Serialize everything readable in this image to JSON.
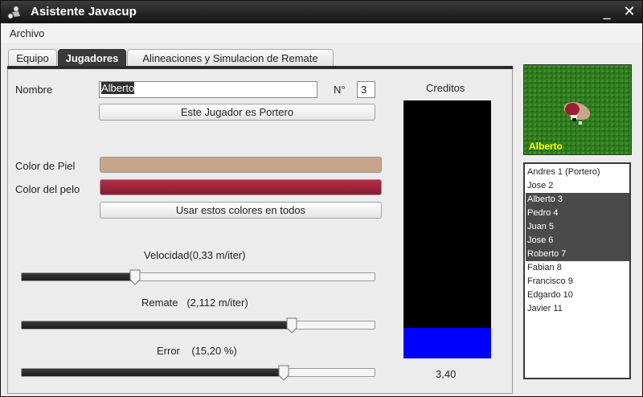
{
  "window": {
    "title": "Asistente Javacup",
    "minimize_glyph": "_",
    "close_glyph": "✕"
  },
  "menu": {
    "archivo": "Archivo"
  },
  "tabs": [
    {
      "label": "Equipo",
      "active": false
    },
    {
      "label": "Jugadores",
      "active": true
    },
    {
      "label": "Alineaciones y Simulacion de Remate",
      "active": false
    }
  ],
  "player": {
    "name_label": "Nombre",
    "name_value": "Alberto",
    "number_label": "N°",
    "number_value": "3",
    "goalkeeper_button": "Este Jugador es Portero",
    "skin_label": "Color de Piel",
    "hair_label": "Color del pelo",
    "skin_color": "#c8a58a",
    "hair_color": "#9a2035",
    "use_colors_button": "Usar estos colores en todos"
  },
  "sliders": {
    "speed": {
      "label": "Velocidad(0,33 m/iter)",
      "fraction": 0.32
    },
    "shot": {
      "label": "Remate   (2,112 m/iter)",
      "fraction": 0.78
    },
    "error": {
      "label": "Error    (15,20 %)",
      "fraction": 0.74
    }
  },
  "credits": {
    "title": "Creditos",
    "value": "3,40",
    "fill_fraction": 0.12
  },
  "preview": {
    "name": "Alberto"
  },
  "players": [
    {
      "label": "Andres 1 (Portero)",
      "selected": false
    },
    {
      "label": "Jose 2",
      "selected": false
    },
    {
      "label": "Alberto 3",
      "selected": true
    },
    {
      "label": "Pedro 4",
      "selected": true
    },
    {
      "label": "Juan 5",
      "selected": true
    },
    {
      "label": "Jose 6",
      "selected": true
    },
    {
      "label": "Roberto 7",
      "selected": true
    },
    {
      "label": "Fabian 8",
      "selected": false
    },
    {
      "label": "Francisco 9",
      "selected": false
    },
    {
      "label": "Edgardo 10",
      "selected": false
    },
    {
      "label": "Javier 11",
      "selected": false
    }
  ],
  "colors": {
    "accent_selected": "#4a4a4a",
    "credits_fill": "#0000ff",
    "field": "#2a6b1a"
  },
  "icons": {
    "app": "soccer-player-icon",
    "minimize": "minimize-icon",
    "close": "close-icon"
  }
}
